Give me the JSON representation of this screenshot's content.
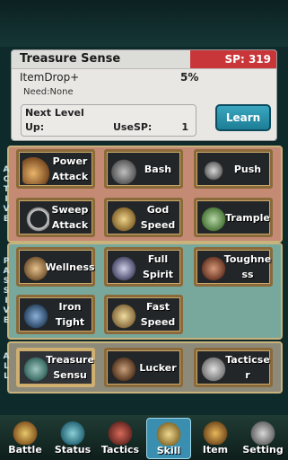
{
  "info": {
    "title": "Treasure Sense",
    "sp": "SP: 319",
    "effect": "ItemDrop+",
    "percent": "5%",
    "need": "Need:None",
    "next_level": "Next Level",
    "up": "Up:",
    "use_sp_label": "UseSP:",
    "use_sp_value": "1",
    "learn": "Learn"
  },
  "sections": {
    "active": "ACTIVE",
    "passive": "PASSIVE",
    "all": "ALL"
  },
  "skills": {
    "power_attack": "Power\nAttack",
    "bash": "Bash",
    "push": "Push",
    "sweep_attack": "Sweep\nAttack",
    "god_speed": "God\nSpeed",
    "trample": "Trample",
    "wellness": "Wellness",
    "full_spirit": "Full\nSpirit",
    "toughness": "Toughne\nss",
    "iron_tight": "Iron\nTight",
    "fast_speed": "Fast\nSpeed",
    "treasure_sensu": "Treasure\nSensu",
    "lucker": "Lucker",
    "tacticser": "Tacticse\nr"
  },
  "nav": {
    "battle": "Battle",
    "status": "Status",
    "tactics": "Tactics",
    "skill": "Skill",
    "item": "Item",
    "setting": "Setting"
  },
  "colors": {
    "sp_bar": "#c9363a",
    "learn_button": "#2a93ad",
    "active_section": "#c48a74",
    "passive_section": "#78a89b",
    "all_section": "#8e8a7a",
    "selected_tab": "#3a8fb0"
  }
}
